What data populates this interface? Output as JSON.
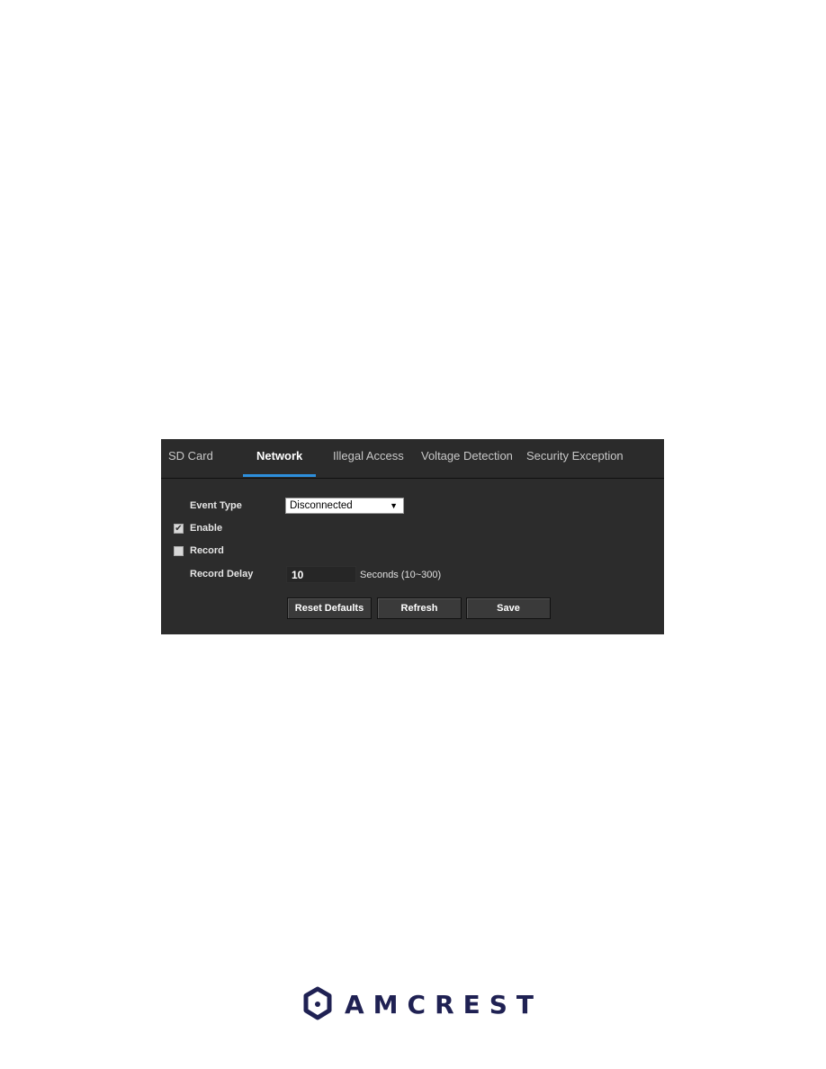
{
  "tabs": [
    {
      "label": "SD Card"
    },
    {
      "label": "Network",
      "active": true
    },
    {
      "label": "Illegal Access"
    },
    {
      "label": "Voltage Detection"
    },
    {
      "label": "Security Exception"
    }
  ],
  "form": {
    "event_type_label": "Event Type",
    "event_type_value": "Disconnected",
    "dropdown_arrow": "▼",
    "enable_label": "Enable",
    "enable_checked": true,
    "record_label": "Record",
    "record_checked": false,
    "record_delay_label": "Record Delay",
    "record_delay_value": "10",
    "record_delay_unit": "Seconds (10~300)"
  },
  "buttons": {
    "reset": "Reset Defaults",
    "refresh": "Refresh",
    "save": "Save"
  },
  "colors": {
    "accent": "#2d8fdc",
    "panel": "#2c2c2c",
    "brand": "#1f2153"
  },
  "logo": {
    "text": "AMCREST"
  }
}
